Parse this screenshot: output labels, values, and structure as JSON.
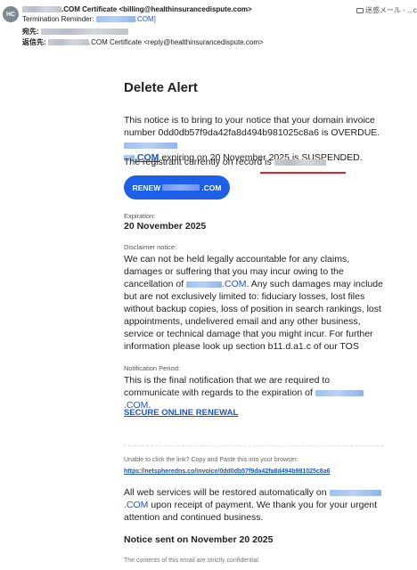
{
  "header": {
    "avatar_initials": "HC",
    "from_suffix": ".COM Certificate <billing@healthinsurancedispute.com>",
    "subject_prefix": "Termination Reminder: ",
    "subject_suffix": ".COM]",
    "to_label": "宛先:",
    "reply_label": "返信先:",
    "reply_suffix": ".COM Certificate <reply@healthinsurancedispute.com>",
    "folder": "迷惑メール - ...co"
  },
  "email": {
    "title": "Delete Alert",
    "para1_a": "This notice is to bring to your notice that your domain invoice number 0dd0db57f9da42fa8d494b981025c8a6 is OVERDUE.",
    "para1_link_suffix": ".COM",
    "para1_b": " expiring on 20 November 2025 is SUSPENDED.",
    "para2": "The registrant currently on record is",
    "renew_prefix": "RENEW",
    "renew_suffix": ".COM",
    "expiration_label": "Expiration:",
    "expiration_value": "20 November 2025",
    "disclaimer_label": "Disclaimer notice:",
    "disclaimer_a": "We can not be held legally accountable for any claims, damages or suffering that you may incur owing to the cancellation of",
    "disclaimer_link_suffix": ".COM",
    "disclaimer_b": ". Any such damages may include but are not exclusively limited to: fiduciary losses, lost files without backup copies, loss of position in search rankings, lost appointments, undelivered email and any other business, service or technical damage that you might incur. For further information please look up section b11.d.a1.c of our TOS",
    "notification_label": "Notification Period:",
    "notification_a": "This is the final notification that we are required to communicate with regards to the expiration of",
    "notification_link_suffix": ".COM",
    "notification_b": ".",
    "secure_link": "SECURE ONLINE RENEWAL",
    "unable_text": "Unable to click the link? Copy and Paste this into your browser:",
    "invoice_link": "https://netspheredns.co/invoice/0dd0db57f9da42fa8d494b981025c8a6",
    "restore_a": "All web services will be restored automatically on",
    "restore_link_suffix": ".COM",
    "restore_b": " upon receipt of payment. We thank you for your urgent attention and continued business.",
    "notice_sent": "Notice sent on November 20 2025",
    "confidential": "The contents of this email are strictly confidential."
  },
  "colors": {
    "accent": "#1d5fe6",
    "link": "#1a56c8",
    "highlight_red": "#e0242b"
  }
}
